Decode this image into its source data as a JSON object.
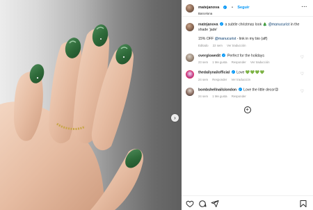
{
  "post": {
    "username": "matejanova",
    "follow_label": "Seguir",
    "location": "Barcelona",
    "more_label": "···",
    "caption": {
      "username": "matejanova",
      "text_part1": "a subtle christmas look 🎄",
      "mention": "@manucurist",
      "text_part2": "in the shade 'jade'",
      "line2_part1": "15% OFF",
      "line2_mention": "@manucurist",
      "line2_part2": "- link in my bio (aff)",
      "edited": "Editado",
      "time": "22 sem",
      "translate": "Ver traducción"
    }
  },
  "comments": [
    {
      "username": "overglowedit",
      "text": "Perfect for the holidays",
      "time": "23 sem",
      "likes": "1 Me gusta",
      "reply": "Responder",
      "translate": "Ver traducción"
    },
    {
      "username": "thedailynailofficial",
      "text": "Love",
      "hearts": "💚💚💚💚",
      "time": "24 sem",
      "likes": "",
      "reply": "Responder",
      "translate": "Ver traducción"
    },
    {
      "username": "bombshellnailslondon",
      "text": "Love the little decor😍",
      "time": "24 sem",
      "likes": "1 Me gusta",
      "reply": "Responder",
      "translate": ""
    }
  ],
  "ui": {
    "next_arrow": "›",
    "load_more": "+",
    "heart_outline": "♡",
    "verified_mark": "✓"
  },
  "colors": {
    "accent": "#0095f6",
    "mention": "#00376b",
    "muted": "#8e8e8e",
    "nail_green": "#2f6b3a"
  },
  "icons": [
    "like-icon",
    "comment-icon",
    "share-icon",
    "save-icon",
    "more-icon",
    "verified-icon"
  ]
}
